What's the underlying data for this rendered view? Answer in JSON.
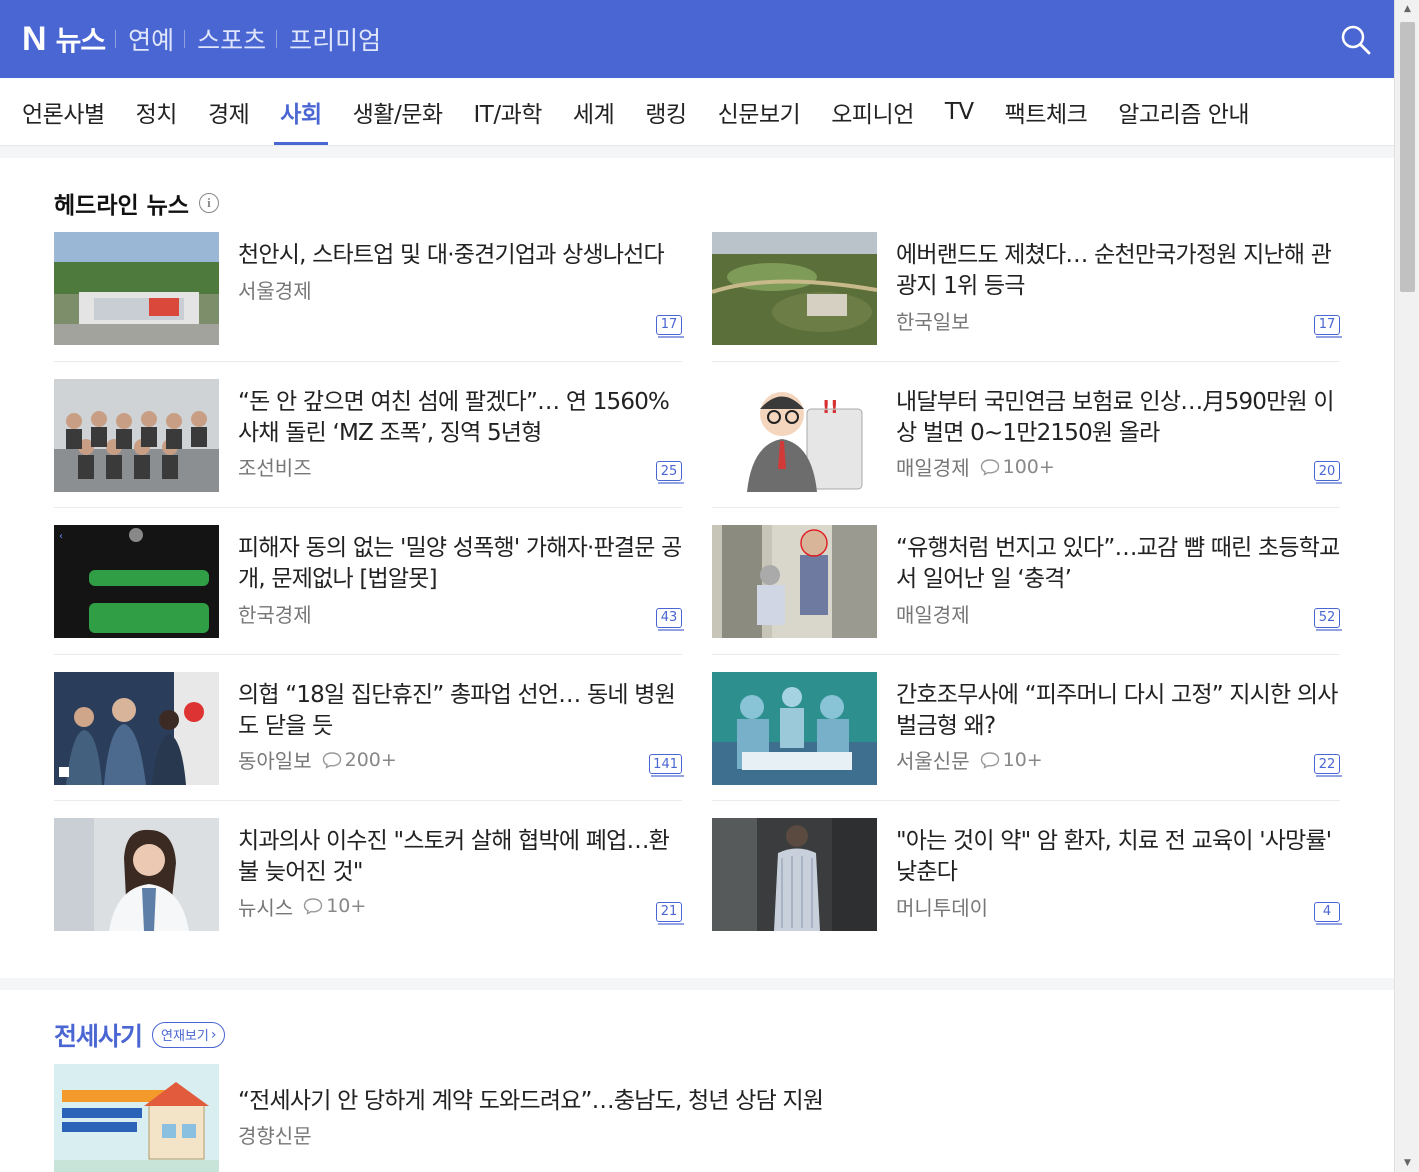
{
  "header": {
    "logo_n": "N",
    "logo_text": "뉴스",
    "services": [
      "연예",
      "스포츠",
      "프리미엄"
    ]
  },
  "nav": [
    {
      "label": "언론사별",
      "active": false
    },
    {
      "label": "정치",
      "active": false
    },
    {
      "label": "경제",
      "active": false
    },
    {
      "label": "사회",
      "active": true
    },
    {
      "label": "생활/문화",
      "active": false
    },
    {
      "label": "IT/과학",
      "active": false
    },
    {
      "label": "세계",
      "active": false
    },
    {
      "label": "랭킹",
      "active": false
    },
    {
      "label": "신문보기",
      "active": false
    },
    {
      "label": "오피니언",
      "active": false
    },
    {
      "label": "TV",
      "active": false
    },
    {
      "label": "팩트체크",
      "active": false
    },
    {
      "label": "알고리즘 안내",
      "active": false
    }
  ],
  "headline": {
    "title": "헤드라인 뉴스",
    "info_icon": "i",
    "articles": [
      {
        "title": "천안시, 스타트업 및 대·중견기업과 상생나선다",
        "press": "서울경제",
        "comments": "",
        "count": "17",
        "thumb": "city-hall-aerial"
      },
      {
        "title": "에버랜드도 제쳤다… 순천만국가정원 지난해 관광지 1위 등극",
        "press": "한국일보",
        "comments": "",
        "count": "17",
        "thumb": "garden-aerial"
      },
      {
        "title": "“돈 안 갚으면 여친 섬에 팔겠다”… 연 1560% 사채 돌린 ‘MZ 조폭’, 징역 5년형",
        "press": "조선비즈",
        "comments": "",
        "count": "25",
        "thumb": "group-photo"
      },
      {
        "title": "내달부터 국민연금 보험료 인상…月590만원 이상 벌면 0~1만2150원 올라",
        "press": "매일경제",
        "comments": "100+",
        "count": "20",
        "thumb": "cartoon-man-monitor"
      },
      {
        "title": "피해자 동의 없는 '밀양 성폭행' 가해자·판결문 공개, 문제없나 [법알못]",
        "press": "한국경제",
        "comments": "",
        "count": "43",
        "thumb": "phone-chat"
      },
      {
        "title": "“유행처럼 번지고 있다”…교감 뺨 때린 초등학교서 일어난 일 ‘충격’",
        "press": "매일경제",
        "comments": "",
        "count": "52",
        "thumb": "school-hallway"
      },
      {
        "title": "의협 “18일 집단휴진” 총파업 선언… 동네 병원도 닫을 듯",
        "press": "동아일보",
        "comments": "200+",
        "count": "141",
        "thumb": "officials-briefing"
      },
      {
        "title": "간호조무사에 “피주머니 다시 고정” 지시한 의사 벌금형 왜?",
        "press": "서울신문",
        "comments": "10+",
        "count": "22",
        "thumb": "surgery-illustration"
      },
      {
        "title": "치과의사 이수진 \"스토커 살해 협박에 폐업…환불 늦어진 것\"",
        "press": "뉴시스",
        "comments": "10+",
        "count": "21",
        "thumb": "doctor-portrait"
      },
      {
        "title": "\"아는 것이 약\" 암 환자, 치료 전 교육이 '사망률' 낮춘다",
        "press": "머니투데이",
        "comments": "",
        "count": "4",
        "thumb": "patient-back"
      }
    ]
  },
  "series": {
    "name": "전세사기",
    "button": "연재보기",
    "article": {
      "title": "“전세사기 안 당하게 계약 도와드려요”…충남도, 청년 상담 지원",
      "press": "경향신문",
      "thumb": "poster-housing"
    }
  },
  "colors": {
    "brand": "#4a66d3",
    "text": "#222222",
    "meta": "#777777"
  }
}
